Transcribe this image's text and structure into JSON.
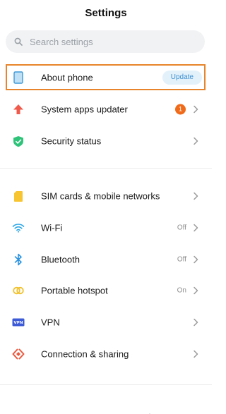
{
  "header": {
    "title": "Settings"
  },
  "search": {
    "placeholder": "Search settings"
  },
  "items": [
    {
      "label": "About phone",
      "action": "Update"
    },
    {
      "label": "System apps updater",
      "badge": "1"
    },
    {
      "label": "Security status"
    },
    {
      "label": "SIM cards & mobile networks"
    },
    {
      "label": "Wi-Fi",
      "value": "Off"
    },
    {
      "label": "Bluetooth",
      "value": "Off"
    },
    {
      "label": "Portable hotspot",
      "value": "On"
    },
    {
      "label": "VPN",
      "icon_text": "VPN"
    },
    {
      "label": "Connection & sharing"
    }
  ],
  "colors": {
    "highlight": "#e8842b",
    "badge": "#f06a1a",
    "update_bg": "#e3f1fb",
    "update_text": "#3a8fd0"
  },
  "icons": [
    "search-icon",
    "phone-icon",
    "arrow-up-icon",
    "shield-check-icon",
    "sim-card-icon",
    "wifi-icon",
    "bluetooth-icon",
    "hotspot-icon",
    "vpn-icon",
    "connection-sharing-icon",
    "chevron-right-icon"
  ]
}
